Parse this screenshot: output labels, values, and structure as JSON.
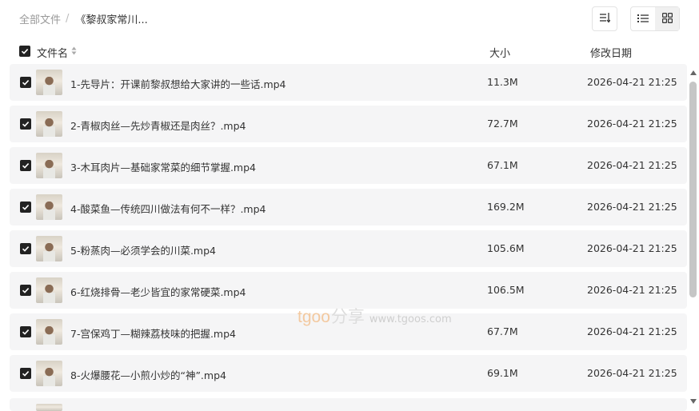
{
  "breadcrumb": {
    "root": "全部文件",
    "separator": "/",
    "current": "《黎叔家常川..."
  },
  "toolbar": {
    "sort_icon": "sort-icon",
    "list_view_icon": "list-view-icon",
    "grid_view_icon": "grid-view-icon",
    "active_view": "list"
  },
  "header": {
    "name": "文件名",
    "size": "大小",
    "date": "修改日期",
    "select_all_checked": true
  },
  "files": [
    {
      "name": "1-先导片：开课前黎叔想给大家讲的一些话.mp4",
      "size": "11.3M",
      "date": "2026-04-21 21:25",
      "checked": true
    },
    {
      "name": "2-青椒肉丝—先炒青椒还是肉丝？.mp4",
      "size": "72.7M",
      "date": "2026-04-21 21:25",
      "checked": true
    },
    {
      "name": "3-木耳肉片—基础家常菜的细节掌握.mp4",
      "size": "67.1M",
      "date": "2026-04-21 21:25",
      "checked": true
    },
    {
      "name": "4-酸菜鱼—传统四川做法有何不一样？.mp4",
      "size": "169.2M",
      "date": "2026-04-21 21:25",
      "checked": true
    },
    {
      "name": "5-粉蒸肉—必须学会的川菜.mp4",
      "size": "105.6M",
      "date": "2026-04-21 21:25",
      "checked": true
    },
    {
      "name": "6-红烧排骨—老少皆宜的家常硬菜.mp4",
      "size": "106.5M",
      "date": "2026-04-21 21:25",
      "checked": true
    },
    {
      "name": "7-宫保鸡丁—糊辣荔枝味的把握.mp4",
      "size": "67.7M",
      "date": "2026-04-21 21:25",
      "checked": true
    },
    {
      "name": "8-火爆腰花—小煎小炒的“神”.mp4",
      "size": "69.1M",
      "date": "2026-04-21 21:25",
      "checked": true
    }
  ],
  "watermark": {
    "brand": "tgoo",
    "share": "分享",
    "url": "www.tgoos.com"
  },
  "colors": {
    "row_bg": "#f5f5f6",
    "checkbox": "#222222",
    "scrollbar": "#c6c6c6"
  }
}
